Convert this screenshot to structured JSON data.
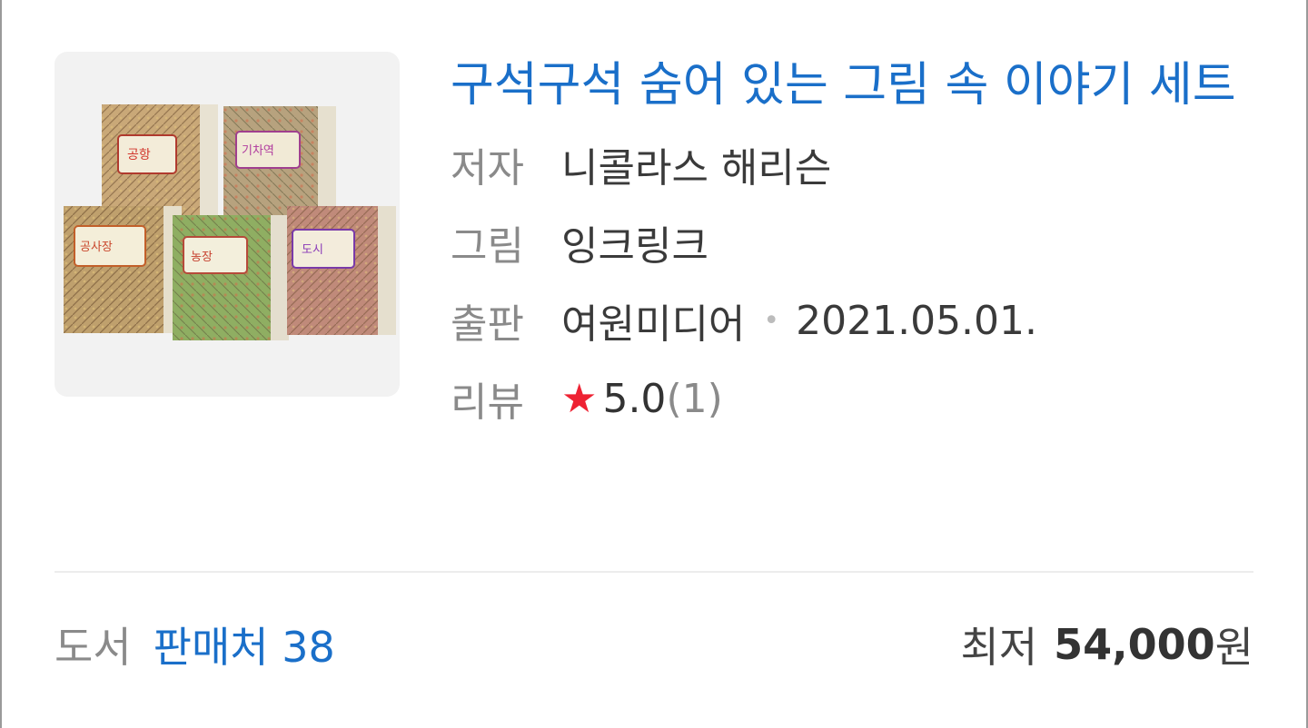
{
  "product": {
    "title": "구석구석 숨어 있는 그림 속 이야기 세트",
    "thumbnail_icon": "book-set-cover-image",
    "meta": {
      "author_label": "저자",
      "author": "니콜라스 해리슨",
      "illustrator_label": "그림",
      "illustrator": "잉크링크",
      "publisher_label": "출판",
      "publisher": "여원미디어",
      "separator": "•",
      "pub_date": "2021.05.01.",
      "review_label": "리뷰",
      "star_icon": "star-icon",
      "rating": "5.0",
      "review_count": "(1)"
    }
  },
  "footer": {
    "category": "도서",
    "sellers": "판매처 38",
    "min_label": "최저",
    "price": "54,000",
    "currency": "원"
  },
  "colors": {
    "link_blue": "#1a6fc9",
    "star_red": "#ee2233",
    "label_gray": "#8a8a8a",
    "text_dark": "#333333"
  }
}
